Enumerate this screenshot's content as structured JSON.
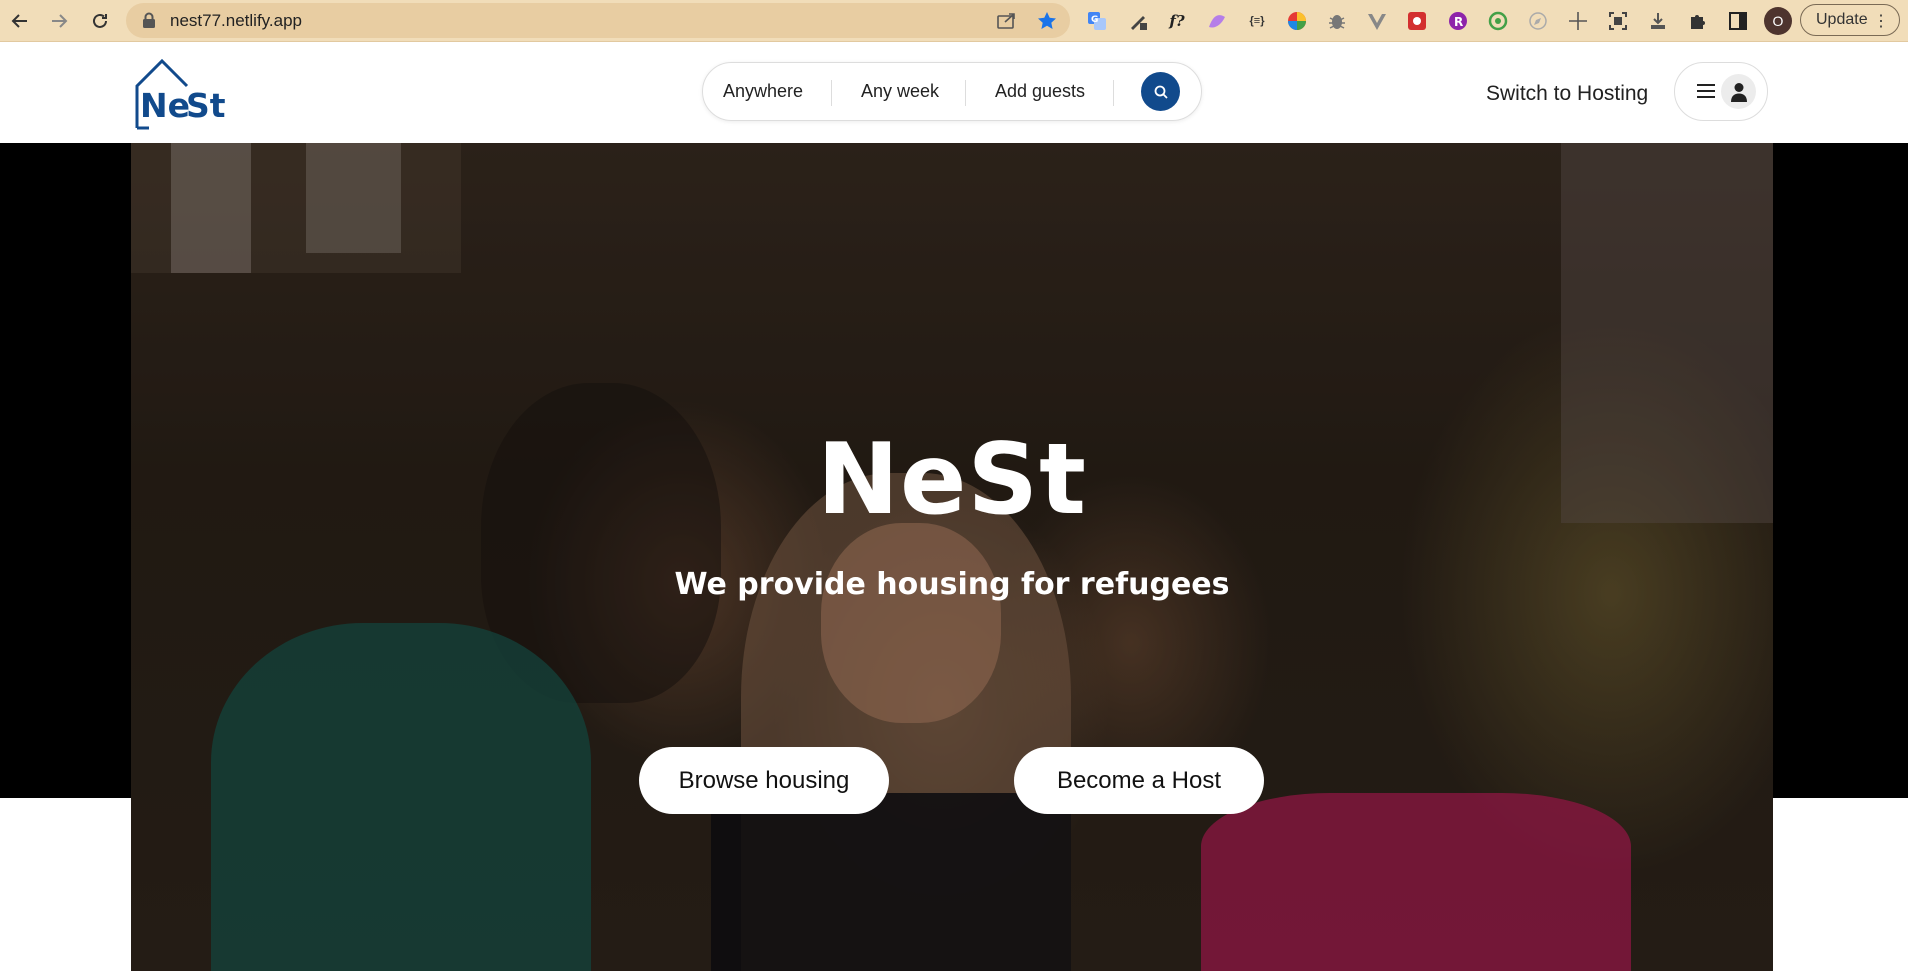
{
  "browser": {
    "url": "nest77.netlify.app",
    "profile_initial": "O",
    "update_label": "Update",
    "extensions": [
      "translate-icon",
      "pen-tool-icon",
      "f-question-icon",
      "rainbow-pen-icon",
      "curly-braces-icon",
      "color-wheel-icon",
      "bug-icon",
      "vue-icon",
      "red-extension-icon",
      "letter-r-icon",
      "green-face-icon",
      "compass-icon",
      "move-arrows-icon",
      "screenshot-icon",
      "download-icon",
      "puzzle-icon",
      "side-panel-icon"
    ],
    "ext_f_label": "f?",
    "ext_braces_label": "{≡}"
  },
  "logo": {
    "text_ne": "Ne",
    "text_st": "St",
    "color": "#114a8c"
  },
  "search": {
    "where": "Anywhere",
    "when": "Any week",
    "who": "Add guests"
  },
  "header": {
    "switch_label": "Switch to Hosting"
  },
  "hero": {
    "title": "NeSt",
    "subtitle": "We provide housing for refugees",
    "browse_label": "Browse housing",
    "host_label": "Become a Host"
  },
  "colors": {
    "brand": "#114a8c",
    "chrome": "#f1ddb9"
  }
}
